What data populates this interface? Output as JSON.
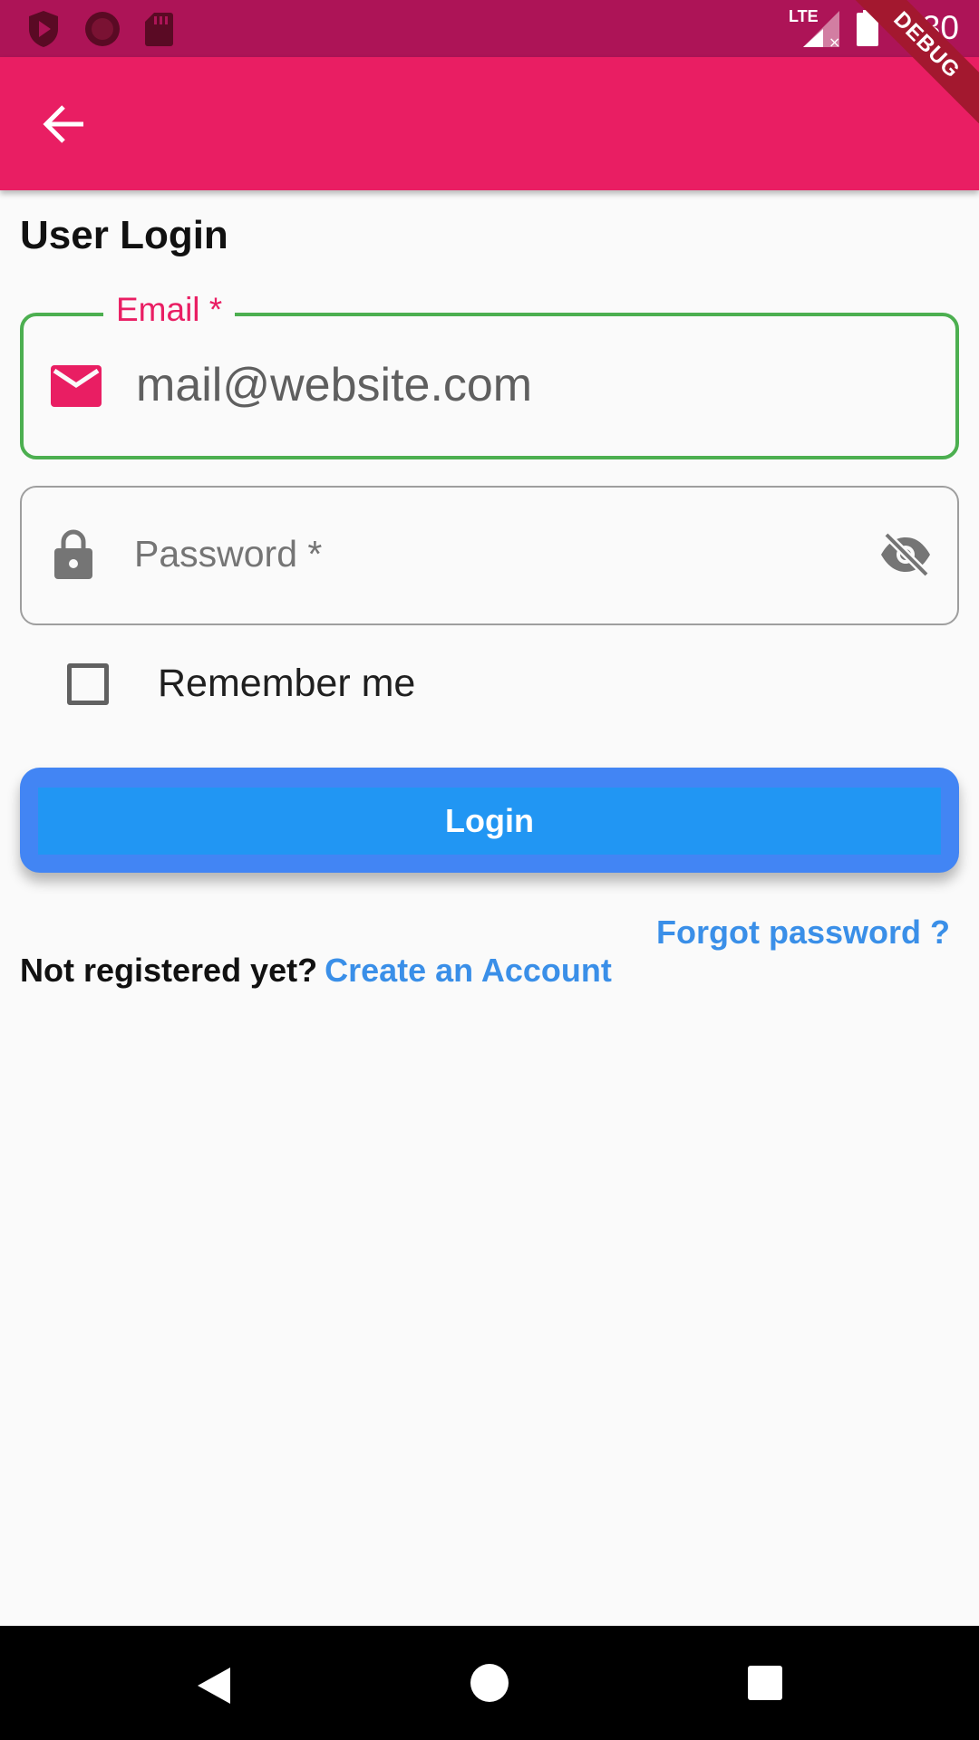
{
  "status_bar": {
    "time": "6:30",
    "network_label": "LTE",
    "icons": [
      "shield-play-icon",
      "record-icon",
      "sd-card-icon",
      "signal-icon",
      "battery-icon"
    ]
  },
  "debug_banner": "DEBUG",
  "app_bar": {
    "color": "#e91e63",
    "back_icon": "arrow-back-icon"
  },
  "page": {
    "title": "User Login"
  },
  "email": {
    "label": "Email *",
    "value": "mail@website.com",
    "icon": "mail-icon",
    "border_color": "#4caf50"
  },
  "password": {
    "placeholder": "Password *",
    "icon": "lock-icon",
    "toggle_icon": "visibility-off-icon"
  },
  "remember": {
    "label": "Remember me",
    "checked": false
  },
  "login_button": {
    "label": "Login"
  },
  "forgot_password": "Forgot password ?",
  "register": {
    "text": "Not registered yet?",
    "link": "Create an Account"
  },
  "nav_bar": {
    "icons": [
      "nav-back-icon",
      "nav-home-icon",
      "nav-recents-icon"
    ]
  }
}
